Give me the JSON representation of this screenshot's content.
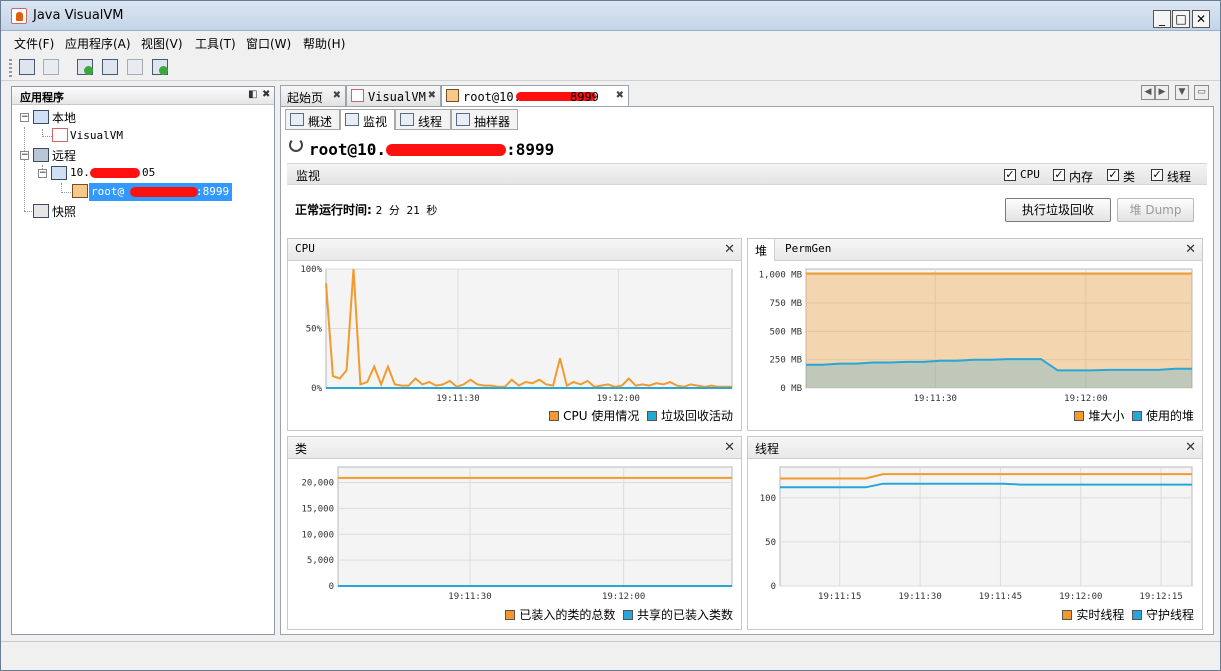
{
  "window": {
    "title": "Java VisualVM"
  },
  "menu": [
    "文件(F)",
    "应用程序(A)",
    "视图(V)",
    "工具(T)",
    "窗口(W)",
    "帮助(H)"
  ],
  "sidebar": {
    "title": "应用程序",
    "nodes": {
      "local": "本地",
      "visualvm": "VisualVM",
      "remote": "远程",
      "host_prefix": "10.",
      "host_suffix": "05",
      "jmx_prefix": "root@",
      "jmx_suffix": ":8999",
      "snapshots": "快照"
    }
  },
  "tabs": {
    "start": "起始页",
    "visualvm": "VisualVM",
    "conn_prefix": "root@10.",
    "conn_suffix": "8999"
  },
  "subtabs": [
    "概述",
    "监视",
    "线程",
    "抽样器"
  ],
  "connection": {
    "title_prefix": "root@10.",
    "title_suffix": ":8999"
  },
  "monitor": {
    "section": "监视",
    "checks": [
      {
        "label": "CPU",
        "checked": true
      },
      {
        "label": "内存",
        "checked": true
      },
      {
        "label": "类",
        "checked": true
      },
      {
        "label": "线程",
        "checked": true
      }
    ],
    "uptime_label": "正常运行时间:",
    "uptime_value": "2 分 21 秒",
    "gc_button": "执行垃圾回收",
    "heapdump_button": "堆 Dump"
  },
  "charts": {
    "cpu": {
      "title": "CPU",
      "legend": [
        "CPU 使用情况",
        "垃圾回收活动"
      ]
    },
    "heap": {
      "tabs": [
        "堆",
        "PermGen"
      ],
      "legend": [
        "堆大小",
        "使用的堆"
      ]
    },
    "classes": {
      "title": "类",
      "legend": [
        "已装入的类的总数",
        "共享的已装入类数"
      ]
    },
    "threads": {
      "title": "线程",
      "legend": [
        "实时线程",
        "守护线程"
      ]
    }
  },
  "colors": {
    "orange": "#f29a2e",
    "blue": "#27a6d8"
  },
  "chart_data": [
    {
      "type": "line",
      "title": "CPU",
      "x_ticks": [
        "19:11:30",
        "19:12:00"
      ],
      "y_ticks": [
        "0%",
        "50%",
        "100%"
      ],
      "ylim": [
        0,
        100
      ],
      "series": [
        {
          "name": "CPU 使用情况",
          "color": "#f29a2e",
          "values": [
            88,
            10,
            8,
            15,
            100,
            3,
            5,
            18,
            3,
            18,
            3,
            2,
            2,
            8,
            3,
            5,
            2,
            3,
            6,
            1,
            3,
            7,
            3,
            2,
            2,
            1,
            1,
            7,
            2,
            5,
            4,
            7,
            3,
            2,
            25,
            2,
            5,
            3,
            6,
            1,
            2,
            3,
            1,
            2,
            8,
            2,
            3,
            2,
            4,
            3,
            5,
            2,
            1,
            3,
            2,
            1,
            2,
            1,
            1,
            1
          ]
        },
        {
          "name": "垃圾回收活动",
          "color": "#27a6d8",
          "values": [
            0,
            0,
            0,
            0,
            0,
            0,
            0,
            0,
            0,
            0,
            0,
            0,
            0,
            0,
            0,
            0,
            0,
            0,
            0,
            0,
            0,
            0,
            0,
            0,
            0,
            0,
            0,
            0,
            0,
            0,
            0,
            0,
            0,
            0,
            0,
            0,
            0,
            0,
            0,
            0,
            0,
            0,
            0,
            0,
            0,
            0,
            0,
            0,
            0,
            0,
            0,
            0,
            0,
            0,
            0,
            0,
            0,
            0,
            0,
            0
          ]
        }
      ]
    },
    {
      "type": "area",
      "title": "堆",
      "x_ticks": [
        "19:11:30",
        "19:12:00"
      ],
      "y_ticks": [
        "0 MB",
        "250 MB",
        "500 MB",
        "750 MB",
        "1,000 MB"
      ],
      "ylim": [
        0,
        1050
      ],
      "series": [
        {
          "name": "堆大小",
          "color": "#f29a2e",
          "values": [
            1010,
            1010,
            1010,
            1010,
            1010,
            1010,
            1010,
            1010,
            1010,
            1010,
            1010,
            1010,
            1010,
            1010,
            1010,
            1010,
            1010,
            1010,
            1010,
            1010,
            1010,
            1010,
            1010,
            1010
          ]
        },
        {
          "name": "使用的堆",
          "color": "#27a6d8",
          "values": [
            205,
            205,
            215,
            215,
            225,
            225,
            230,
            230,
            240,
            240,
            250,
            250,
            255,
            255,
            255,
            155,
            155,
            155,
            160,
            160,
            160,
            160,
            170,
            170
          ]
        }
      ]
    },
    {
      "type": "line",
      "title": "类",
      "x_ticks": [
        "19:11:30",
        "19:12:00"
      ],
      "y_ticks": [
        "0",
        "5,000",
        "10,000",
        "15,000",
        "20,000"
      ],
      "ylim": [
        0,
        23000
      ],
      "series": [
        {
          "name": "已装入的类的总数",
          "color": "#f29a2e",
          "values": [
            20900,
            20900,
            20900,
            20900,
            20900,
            20900,
            20900,
            20900,
            20900,
            20900
          ]
        },
        {
          "name": "共享的已装入类数",
          "color": "#27a6d8",
          "values": [
            0,
            0,
            0,
            0,
            0,
            0,
            0,
            0,
            0,
            0
          ]
        }
      ]
    },
    {
      "type": "line",
      "title": "线程",
      "x_ticks": [
        "19:11:15",
        "19:11:30",
        "19:11:45",
        "19:12:00",
        "19:12:15"
      ],
      "y_ticks": [
        "0",
        "50",
        "100"
      ],
      "ylim": [
        0,
        135
      ],
      "series": [
        {
          "name": "实时线程",
          "color": "#f29a2e",
          "values": [
            122,
            122,
            122,
            122,
            122,
            122,
            127,
            127,
            127,
            127,
            127,
            127,
            127,
            127,
            127,
            127,
            127,
            127,
            127,
            127,
            127,
            127,
            127,
            127,
            127
          ]
        },
        {
          "name": "守护线程",
          "color": "#27a6d8",
          "values": [
            112,
            112,
            112,
            112,
            112,
            112,
            116,
            116,
            116,
            116,
            116,
            116,
            116,
            116,
            115,
            115,
            115,
            115,
            115,
            115,
            115,
            115,
            115,
            115,
            115
          ]
        }
      ]
    }
  ]
}
